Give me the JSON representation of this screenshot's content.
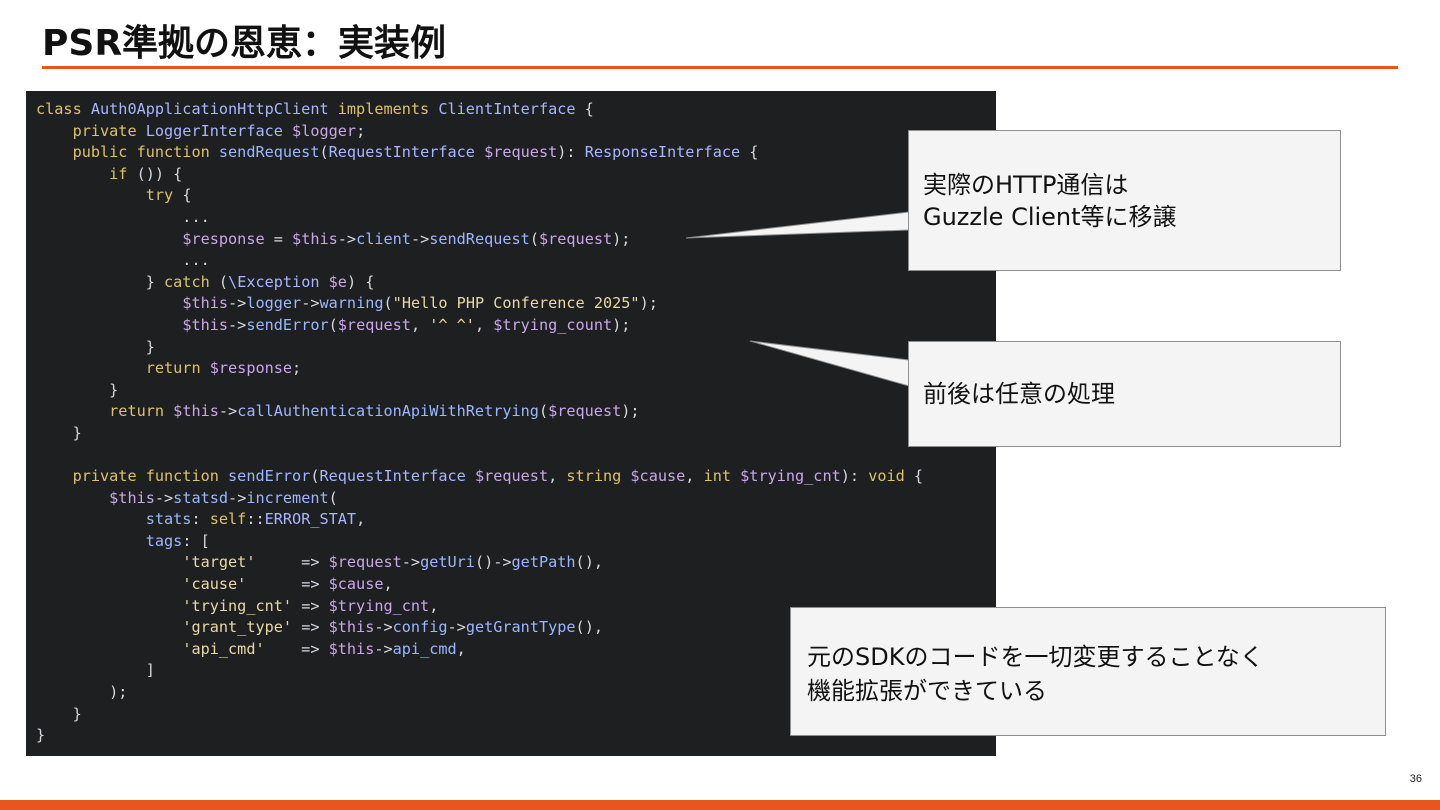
{
  "slide": {
    "title": "PSR準拠の恩恵：実装例",
    "page_number": "36",
    "accent_color": "#e8561f"
  },
  "code": {
    "lines": [
      [
        [
          "k",
          "class "
        ],
        [
          "t",
          "Auth0ApplicationHttpClient "
        ],
        [
          "k",
          "implements "
        ],
        [
          "t",
          "ClientInterface "
        ],
        [
          "n",
          "{"
        ]
      ],
      [
        [
          "n",
          "    "
        ],
        [
          "k",
          "private "
        ],
        [
          "t",
          "LoggerInterface "
        ],
        [
          "v",
          "$logger"
        ],
        [
          "n",
          ";"
        ]
      ],
      [
        [
          "n",
          "    "
        ],
        [
          "k",
          "public function "
        ],
        [
          "f",
          "sendRequest"
        ],
        [
          "n",
          "("
        ],
        [
          "t",
          "RequestInterface "
        ],
        [
          "v",
          "$request"
        ],
        [
          "n",
          "): "
        ],
        [
          "t",
          "ResponseInterface "
        ],
        [
          "n",
          "{"
        ]
      ],
      [
        [
          "n",
          "        "
        ],
        [
          "k",
          "if "
        ],
        [
          "n",
          "()) {"
        ]
      ],
      [
        [
          "n",
          "            "
        ],
        [
          "k",
          "try "
        ],
        [
          "n",
          "{"
        ]
      ],
      [
        [
          "n",
          "                ..."
        ]
      ],
      [
        [
          "n",
          "                "
        ],
        [
          "v",
          "$response"
        ],
        [
          "n",
          " = "
        ],
        [
          "v",
          "$this"
        ],
        [
          "n",
          "->"
        ],
        [
          "f",
          "client"
        ],
        [
          "n",
          "->"
        ],
        [
          "f",
          "sendRequest"
        ],
        [
          "n",
          "("
        ],
        [
          "v",
          "$request"
        ],
        [
          "n",
          ");"
        ]
      ],
      [
        [
          "n",
          "                ..."
        ]
      ],
      [
        [
          "n",
          "            } "
        ],
        [
          "k",
          "catch "
        ],
        [
          "n",
          "("
        ],
        [
          "t",
          "\\Exception "
        ],
        [
          "v",
          "$e"
        ],
        [
          "n",
          ") {"
        ]
      ],
      [
        [
          "n",
          "                "
        ],
        [
          "v",
          "$this"
        ],
        [
          "n",
          "->"
        ],
        [
          "f",
          "logger"
        ],
        [
          "n",
          "->"
        ],
        [
          "f",
          "warning"
        ],
        [
          "n",
          "("
        ],
        [
          "s",
          "\"Hello PHP Conference 2025\""
        ],
        [
          "n",
          ");"
        ]
      ],
      [
        [
          "n",
          "                "
        ],
        [
          "v",
          "$this"
        ],
        [
          "n",
          "->"
        ],
        [
          "f",
          "sendError"
        ],
        [
          "n",
          "("
        ],
        [
          "v",
          "$request"
        ],
        [
          "n",
          ", "
        ],
        [
          "s",
          "'^ ^'"
        ],
        [
          "n",
          ", "
        ],
        [
          "v",
          "$trying_count"
        ],
        [
          "n",
          ");"
        ]
      ],
      [
        [
          "n",
          "            }"
        ]
      ],
      [
        [
          "n",
          "            "
        ],
        [
          "k",
          "return "
        ],
        [
          "v",
          "$response"
        ],
        [
          "n",
          ";"
        ]
      ],
      [
        [
          "n",
          "        }"
        ]
      ],
      [
        [
          "n",
          "        "
        ],
        [
          "k",
          "return "
        ],
        [
          "v",
          "$this"
        ],
        [
          "n",
          "->"
        ],
        [
          "f",
          "callAuthenticationApiWithRetrying"
        ],
        [
          "n",
          "("
        ],
        [
          "v",
          "$request"
        ],
        [
          "n",
          ");"
        ]
      ],
      [
        [
          "n",
          "    }"
        ]
      ],
      [
        [
          "n",
          ""
        ]
      ],
      [
        [
          "n",
          "    "
        ],
        [
          "k",
          "private function "
        ],
        [
          "f",
          "sendError"
        ],
        [
          "n",
          "("
        ],
        [
          "t",
          "RequestInterface "
        ],
        [
          "v",
          "$request"
        ],
        [
          "n",
          ", "
        ],
        [
          "k",
          "string "
        ],
        [
          "v",
          "$cause"
        ],
        [
          "n",
          ", "
        ],
        [
          "k",
          "int "
        ],
        [
          "v",
          "$trying_cnt"
        ],
        [
          "n",
          "): "
        ],
        [
          "k",
          "void "
        ],
        [
          "n",
          "{"
        ]
      ],
      [
        [
          "n",
          "        "
        ],
        [
          "v",
          "$this"
        ],
        [
          "n",
          "->"
        ],
        [
          "f",
          "statsd"
        ],
        [
          "n",
          "->"
        ],
        [
          "f",
          "increment"
        ],
        [
          "n",
          "("
        ]
      ],
      [
        [
          "n",
          "            "
        ],
        [
          "f",
          "stats"
        ],
        [
          "n",
          ": "
        ],
        [
          "k",
          "self"
        ],
        [
          "n",
          "::"
        ],
        [
          "t",
          "ERROR_STAT"
        ],
        [
          "n",
          ","
        ]
      ],
      [
        [
          "n",
          "            "
        ],
        [
          "f",
          "tags"
        ],
        [
          "n",
          ": ["
        ]
      ],
      [
        [
          "n",
          "                "
        ],
        [
          "s",
          "'target'"
        ],
        [
          "n",
          "     => "
        ],
        [
          "v",
          "$request"
        ],
        [
          "n",
          "->"
        ],
        [
          "f",
          "getUri"
        ],
        [
          "n",
          "()->"
        ],
        [
          "f",
          "getPath"
        ],
        [
          "n",
          "(),"
        ]
      ],
      [
        [
          "n",
          "                "
        ],
        [
          "s",
          "'cause'"
        ],
        [
          "n",
          "      => "
        ],
        [
          "v",
          "$cause"
        ],
        [
          "n",
          ","
        ]
      ],
      [
        [
          "n",
          "                "
        ],
        [
          "s",
          "'trying_cnt'"
        ],
        [
          "n",
          " => "
        ],
        [
          "v",
          "$trying_cnt"
        ],
        [
          "n",
          ","
        ]
      ],
      [
        [
          "n",
          "                "
        ],
        [
          "s",
          "'grant_type'"
        ],
        [
          "n",
          " => "
        ],
        [
          "v",
          "$this"
        ],
        [
          "n",
          "->"
        ],
        [
          "f",
          "config"
        ],
        [
          "n",
          "->"
        ],
        [
          "f",
          "getGrantType"
        ],
        [
          "n",
          "(),"
        ]
      ],
      [
        [
          "n",
          "                "
        ],
        [
          "s",
          "'api_cmd'"
        ],
        [
          "n",
          "    => "
        ],
        [
          "v",
          "$this"
        ],
        [
          "n",
          "->"
        ],
        [
          "f",
          "api_cmd"
        ],
        [
          "n",
          ","
        ]
      ],
      [
        [
          "n",
          "            ]"
        ]
      ],
      [
        [
          "n",
          "        );"
        ]
      ],
      [
        [
          "n",
          "    }"
        ]
      ],
      [
        [
          "n",
          "}"
        ]
      ]
    ]
  },
  "callouts": {
    "http": {
      "line1": "実際のHTTP通信は",
      "line2": "Guzzle Client等に移譲"
    },
    "processing": {
      "text": "前後は任意の処理"
    },
    "sdk": {
      "line1": "元のSDKのコードを一切変更することなく",
      "line2": "機能拡張ができている"
    }
  }
}
